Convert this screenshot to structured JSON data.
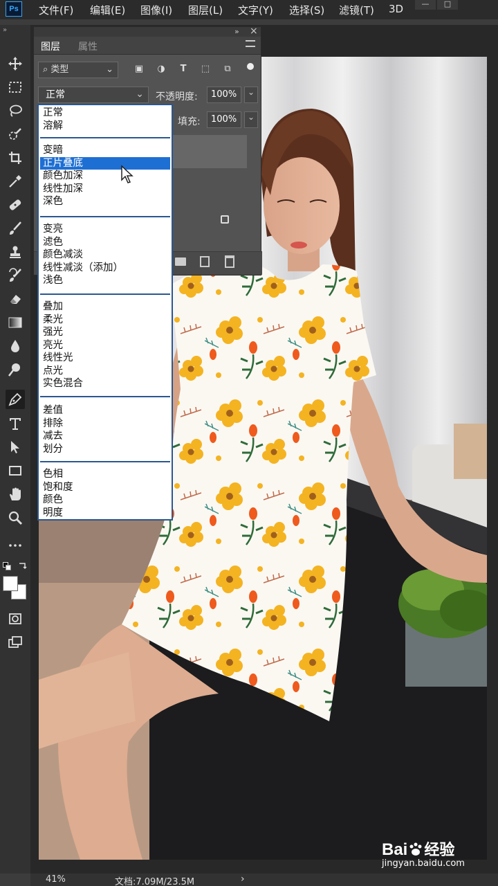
{
  "app": {
    "logo": "Ps"
  },
  "menu": [
    "文件(F)",
    "编辑(E)",
    "图像(I)",
    "图层(L)",
    "文字(Y)",
    "选择(S)",
    "滤镜(T)",
    "3D"
  ],
  "window_controls": [
    "—",
    "□"
  ],
  "layers_panel": {
    "collapse_label": "»",
    "close_label": "×",
    "tabs": [
      "图层",
      "属性"
    ],
    "filter_label": "类型",
    "blend_mode": "正常",
    "opacity_label": "不透明度:",
    "opacity_value": "100%",
    "fill_label": "填充:",
    "fill_value": "100%"
  },
  "blend_dropdown": {
    "groups": [
      [
        "正常",
        "溶解"
      ],
      [
        "变暗",
        "正片叠底",
        "颜色加深",
        "线性加深",
        "深色"
      ],
      [
        "变亮",
        "滤色",
        "颜色减淡",
        "线性减淡（添加）",
        "浅色"
      ],
      [
        "叠加",
        "柔光",
        "强光",
        "亮光",
        "线性光",
        "点光",
        "实色混合"
      ],
      [
        "差值",
        "排除",
        "减去",
        "划分"
      ],
      [
        "色相",
        "饱和度",
        "颜色",
        "明度"
      ]
    ],
    "selected": "正片叠底"
  },
  "statusbar": {
    "zoom": "41%",
    "doc": "文档:7.09M/23.5M",
    "arrow": "›"
  },
  "watermark": {
    "brand": "Bai",
    "brand2": "经验",
    "url": "jingyan.baidu.com"
  },
  "colors": {
    "selected_bg": "#1e6fd3",
    "ps_blue": "#31a8ff",
    "flower_yellow": "#f4b321",
    "flower_orange": "#ef5a1d",
    "leaf_green": "#2e6b3a"
  },
  "icons": [
    "move-icon",
    "marquee-icon",
    "lasso-icon",
    "quick-select-icon",
    "crop-icon",
    "eyedropper-icon",
    "healing-icon",
    "brush-icon",
    "stamp-icon",
    "history-brush-icon",
    "eraser-icon",
    "gradient-icon",
    "blur-icon",
    "dodge-icon",
    "pen-icon",
    "type-icon",
    "path-select-icon",
    "rectangle-icon",
    "hand-icon",
    "zoom-icon",
    "more-icon",
    "swap-colors-icon",
    "color-swatches-icon",
    "quick-mask-icon",
    "screen-mode-icon"
  ]
}
